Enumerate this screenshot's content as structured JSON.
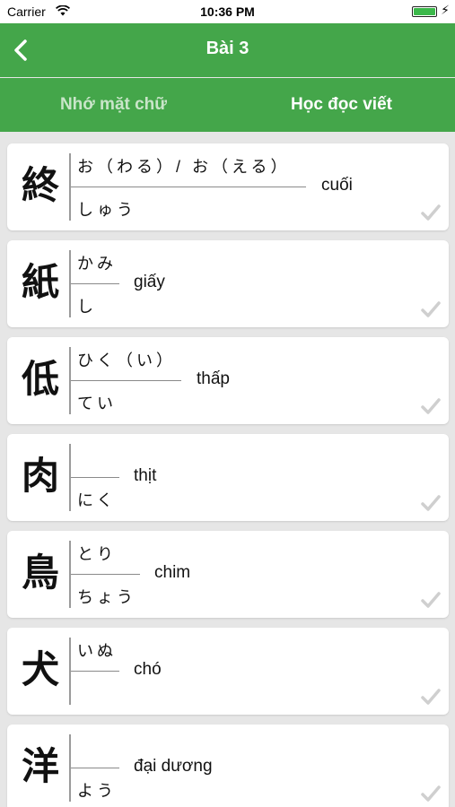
{
  "status_bar": {
    "carrier": "Carrier",
    "time": "10:36 PM",
    "battery_level": 1.0
  },
  "navbar": {
    "title": "Bài 3",
    "back_icon": "chevron-left-icon"
  },
  "tabs": [
    {
      "label": "Nhớ mặt chữ",
      "selected": false
    },
    {
      "label": "Học đọc viết",
      "selected": true
    }
  ],
  "colors": {
    "primary_green": "#44a64a",
    "inactive_tab": "#c9e5c9",
    "background": "#e6e6e6",
    "check": "#cfcfcf"
  },
  "cards": [
    {
      "kanji": "終",
      "reading_top": "お（わる）/ お（える）",
      "reading_bottom": "しゅう",
      "meaning": "cuối"
    },
    {
      "kanji": "紙",
      "reading_top": "かみ",
      "reading_bottom": "し",
      "meaning": "giấy"
    },
    {
      "kanji": "低",
      "reading_top": "ひく（い）",
      "reading_bottom": "てい",
      "meaning": "thấp"
    },
    {
      "kanji": "肉",
      "reading_top": "",
      "reading_bottom": "にく",
      "meaning": "thịt"
    },
    {
      "kanji": "鳥",
      "reading_top": "とり",
      "reading_bottom": "ちょう",
      "meaning": "chim"
    },
    {
      "kanji": "犬",
      "reading_top": "いぬ",
      "reading_bottom": "",
      "meaning": "chó"
    },
    {
      "kanji": "洋",
      "reading_top": "",
      "reading_bottom": "よう",
      "meaning": "đại dương"
    }
  ]
}
